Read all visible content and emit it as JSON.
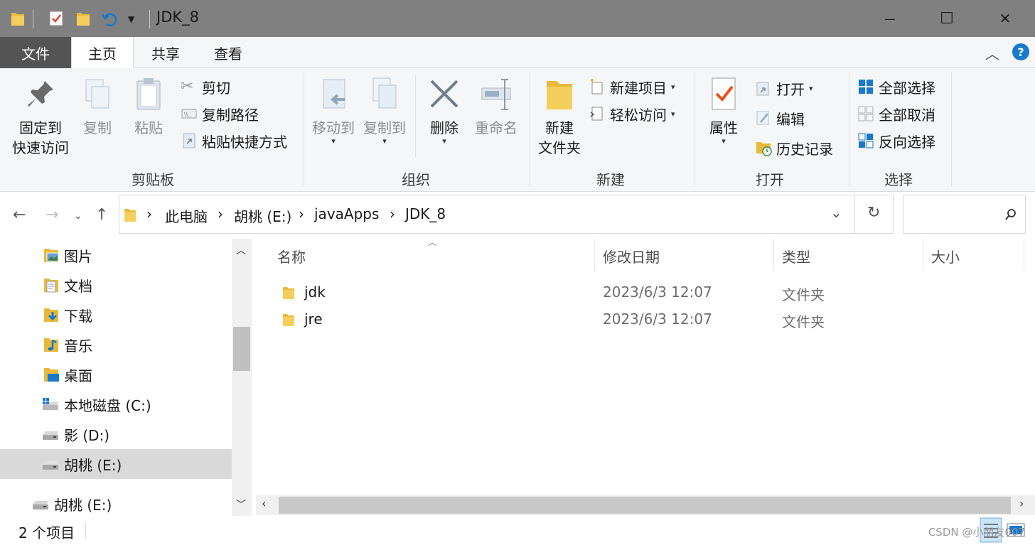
{
  "window": {
    "title": "JDK_8",
    "minimize_glyph": "—",
    "maximize_glyph": "☐",
    "close_glyph": "✕"
  },
  "tabs": {
    "file": "文件",
    "home": "主页",
    "share": "共享",
    "view": "查看"
  },
  "ribbon": {
    "clipboard": {
      "label": "剪贴板",
      "pin": "固定到",
      "pin_line2": "快速访问",
      "copy": "复制",
      "paste": "粘贴",
      "cut": "剪切",
      "copy_path": "复制路径",
      "paste_shortcut": "粘贴快捷方式"
    },
    "organize": {
      "label": "组织",
      "move_to": "移动到",
      "copy_to": "复制到",
      "delete": "删除",
      "rename": "重命名"
    },
    "new": {
      "label": "新建",
      "new_folder": "新建",
      "new_folder_line2": "文件夹",
      "new_item": "新建项目",
      "easy_access": "轻松访问"
    },
    "open": {
      "label": "打开",
      "properties": "属性",
      "open": "打开",
      "edit": "编辑",
      "history": "历史记录"
    },
    "select": {
      "label": "选择",
      "select_all": "全部选择",
      "select_none": "全部取消",
      "invert": "反向选择"
    }
  },
  "address": {
    "crumbs": [
      "此电脑",
      "胡桃 (E:)",
      "javaApps",
      "JDK_8"
    ],
    "separator": "›",
    "search_placeholder": ""
  },
  "navpane": {
    "items": [
      {
        "label": "图片",
        "icon": "pictures-folder-icon"
      },
      {
        "label": "文档",
        "icon": "documents-folder-icon"
      },
      {
        "label": "下载",
        "icon": "downloads-folder-icon"
      },
      {
        "label": "音乐",
        "icon": "music-folder-icon"
      },
      {
        "label": "桌面",
        "icon": "desktop-folder-icon"
      },
      {
        "label": "本地磁盘 (C:)",
        "icon": "system-drive-icon"
      },
      {
        "label": "影 (D:)",
        "icon": "drive-icon"
      },
      {
        "label": "胡桃 (E:)",
        "icon": "drive-icon",
        "selected": true
      },
      {
        "label": "胡桃 (E:)",
        "icon": "drive-icon"
      }
    ]
  },
  "columns": {
    "name": "名称",
    "modified": "修改日期",
    "type": "类型",
    "size": "大小"
  },
  "files": [
    {
      "name": "jdk",
      "modified": "2023/6/3 12:07",
      "type": "文件夹",
      "size": ""
    },
    {
      "name": "jre",
      "modified": "2023/6/3 12:07",
      "type": "文件夹",
      "size": ""
    }
  ],
  "status": {
    "item_count": "2 个项目",
    "watermark": "CSDN @小朋友007"
  },
  "colors": {
    "titlebar": "#808080",
    "file_tab": "#545454",
    "folder": "#e8b93a",
    "accent_blue": "#1979ca",
    "selection": "#d9d9d9"
  }
}
